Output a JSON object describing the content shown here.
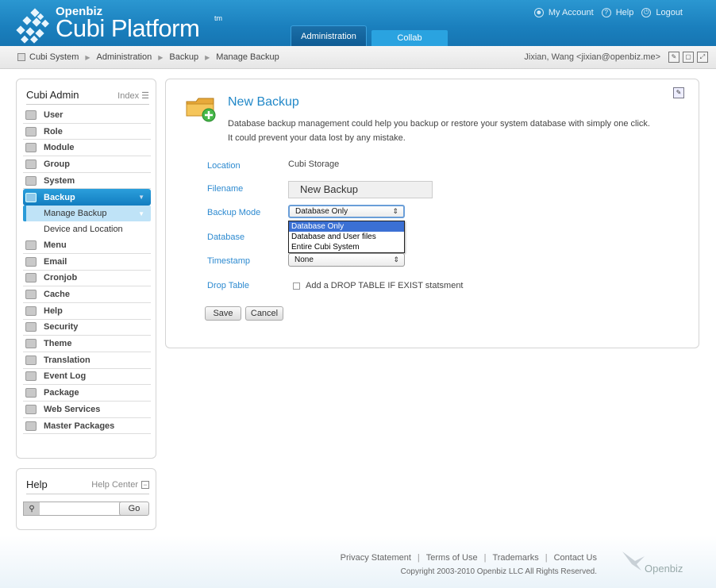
{
  "header": {
    "logo_small": "Openbiz",
    "logo_big": "Cubi Platform",
    "logo_tm": "tm",
    "tabs": [
      "Administration",
      "Collab"
    ],
    "links": [
      "My Account",
      "Help",
      "Logout"
    ]
  },
  "breadcrumb": {
    "items": [
      "Cubi System",
      "Administration",
      "Backup",
      "Manage Backup"
    ],
    "user": "Jixian, Wang <jixian@openbiz.me>"
  },
  "sidebar": {
    "title": "Cubi Admin",
    "index_label": "Index",
    "items": [
      {
        "label": "User",
        "icon": "user-icon"
      },
      {
        "label": "Role",
        "icon": "key-icon"
      },
      {
        "label": "Module",
        "icon": "module-icon"
      },
      {
        "label": "Group",
        "icon": "group-icon"
      },
      {
        "label": "System",
        "icon": "system-icon"
      },
      {
        "label": "Backup",
        "icon": "backup-icon"
      },
      {
        "label": "Menu",
        "icon": "menu-icon"
      },
      {
        "label": "Email",
        "icon": "email-icon"
      },
      {
        "label": "Cronjob",
        "icon": "cronjob-icon"
      },
      {
        "label": "Cache",
        "icon": "cache-icon"
      },
      {
        "label": "Help",
        "icon": "help-icon"
      },
      {
        "label": "Security",
        "icon": "shield-icon"
      },
      {
        "label": "Theme",
        "icon": "theme-icon"
      },
      {
        "label": "Translation",
        "icon": "translation-icon"
      },
      {
        "label": "Event Log",
        "icon": "event-log-icon"
      },
      {
        "label": "Package",
        "icon": "package-icon"
      },
      {
        "label": "Web Services",
        "icon": "web-services-icon"
      },
      {
        "label": "Master Packages",
        "icon": "master-packages-icon"
      }
    ],
    "sub_items": [
      "Manage Backup",
      "Device and Location"
    ]
  },
  "help_box": {
    "title": "Help",
    "center_label": "Help Center",
    "search_value": "",
    "go_label": "Go"
  },
  "main": {
    "title": "New Backup",
    "desc_line1": "Database backup management could help you backup or restore your system database with simply one click.",
    "desc_line2": "It could prevent your data lost by any mistake.",
    "fields": {
      "location_label": "Location",
      "location_value": "Cubi Storage",
      "filename_label": "Filename",
      "filename_value": "New Backup",
      "backup_mode_label": "Backup Mode",
      "backup_mode_value": "Database Only",
      "backup_mode_options": [
        "Database Only",
        "Database and User files",
        "Entire Cubi System"
      ],
      "database_label": "Database",
      "timestamp_label": "Timestamp",
      "timestamp_value": "None",
      "drop_table_label": "Drop Table",
      "drop_table_checkbox_label": "Add a DROP TABLE IF EXIST statsment"
    },
    "save_label": "Save",
    "cancel_label": "Cancel"
  },
  "footer": {
    "links": [
      "Privacy Statement",
      "Terms of Use",
      "Trademarks",
      "Contact Us"
    ],
    "copyright": "Copyright 2003-2010 Openbiz LLC All Rights Reserved.",
    "logo_text": "Openbiz"
  }
}
